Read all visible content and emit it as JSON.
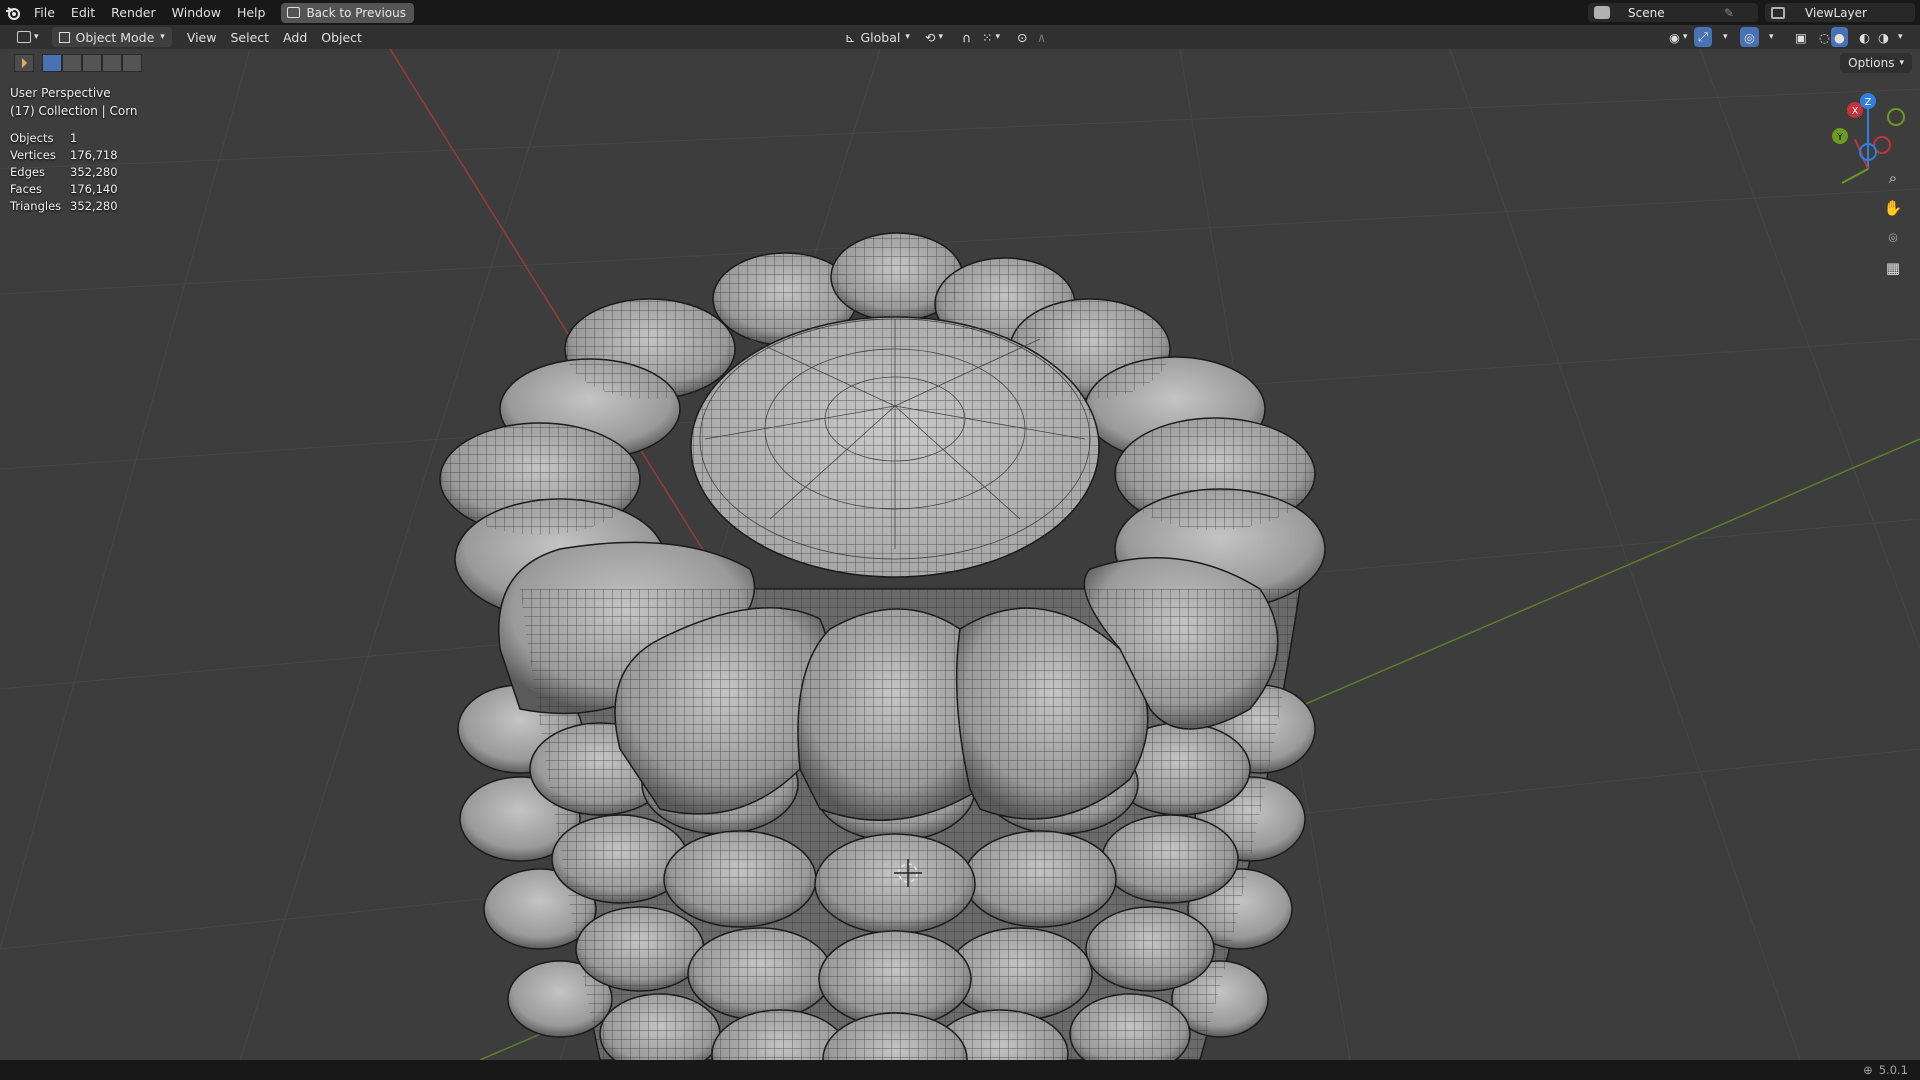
{
  "app": {
    "logo_icon": "blender-logo-icon"
  },
  "topbar": {
    "menu": [
      "File",
      "Edit",
      "Render",
      "Window",
      "Help"
    ],
    "back_label": "Back to Previous",
    "scene_label": "Scene",
    "view_layer_label": "ViewLayer"
  },
  "header": {
    "mode_label": "Object Mode",
    "menus": [
      "View",
      "Select",
      "Add",
      "Object"
    ],
    "transform_orientation": "Global",
    "options_label": "Options"
  },
  "viewport": {
    "perspective": "User Perspective",
    "collection": "(17) Collection | Corn",
    "stats": [
      {
        "k": "Objects",
        "v": "1"
      },
      {
        "k": "Vertices",
        "v": "176,718"
      },
      {
        "k": "Edges",
        "v": "352,280"
      },
      {
        "k": "Faces",
        "v": "176,140"
      },
      {
        "k": "Triangles",
        "v": "352,280"
      }
    ],
    "gizmo": {
      "x": "X",
      "y": "Y",
      "z": "Z"
    }
  },
  "status": {
    "version": "5.0.1"
  },
  "colors": {
    "x_axis": "#c6323a",
    "y_axis": "#6e9a1e",
    "z_axis": "#2f7fe0",
    "grid": "#4a4a4a",
    "bg": "#3d3d3d"
  }
}
